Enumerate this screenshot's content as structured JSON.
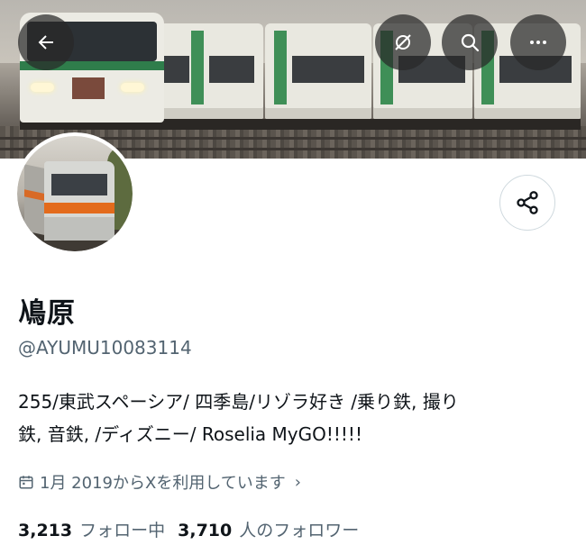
{
  "header": {
    "back_icon": "arrow-left-icon",
    "translate_icon": "grok-translate-icon",
    "search_icon": "search-icon",
    "more_icon": "more-dots-icon"
  },
  "profile": {
    "display_name": "鳰原",
    "handle": "@AYUMU10083114",
    "bio_line1": "255/東武スペーシア/ 四季島/リゾラ好き /乗り鉄, 撮り",
    "bio_line2": "鉄, 音鉄, /ディズニー/ Roselia MyGO!!!!!",
    "joined": "1月 2019からXを利用しています",
    "joined_chevron": "›",
    "following_count": "3,213",
    "following_label": "フォロー中",
    "followers_count": "3,710",
    "followers_label": "人のフォロワー"
  },
  "share_icon": "share-icon"
}
